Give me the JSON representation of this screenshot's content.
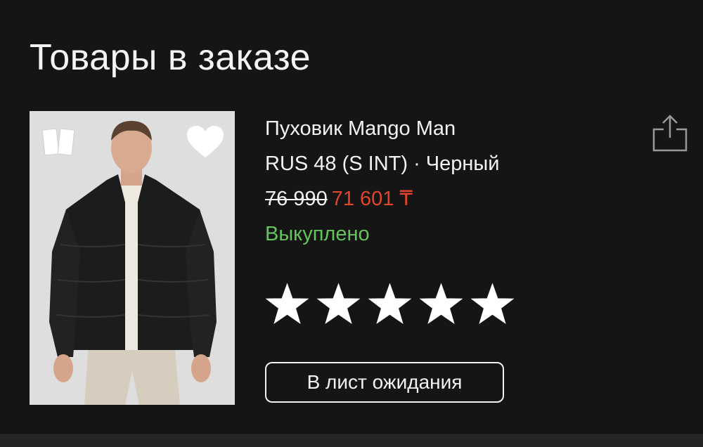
{
  "section": {
    "title": "Товары в заказе"
  },
  "product": {
    "name": "Пуховик Mango Man",
    "variant": "RUS 48 (S INT) · Черный",
    "old_price": "76 990",
    "new_price": "71 601 ₸",
    "status": "Выкуплено",
    "rating": 5,
    "rating_max": 5,
    "waitlist_label": "В лист ожидания"
  },
  "colors": {
    "background": "#151515",
    "text": "#f2f2f2",
    "sale_price": "#e0452c",
    "status_ok": "#63c45b"
  },
  "icons": {
    "compare": "compare-icon",
    "favorite": "heart-icon",
    "share": "share-icon",
    "star": "star-icon"
  }
}
